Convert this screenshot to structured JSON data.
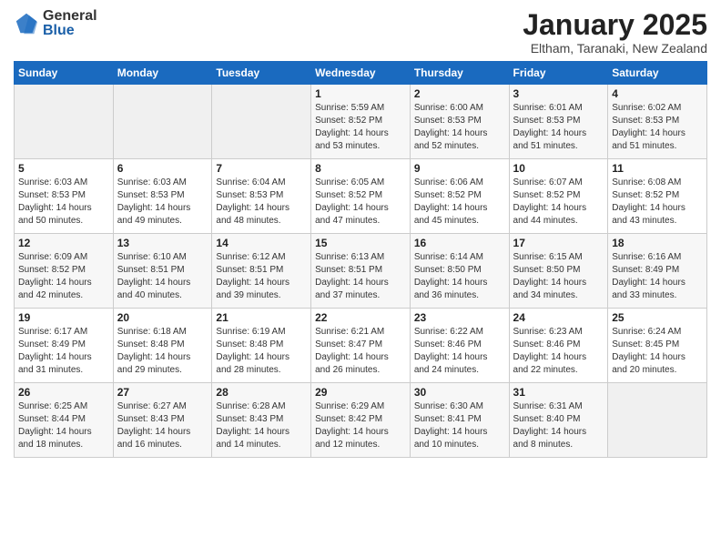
{
  "header": {
    "logo_general": "General",
    "logo_blue": "Blue",
    "month_title": "January 2025",
    "location": "Eltham, Taranaki, New Zealand"
  },
  "days_of_week": [
    "Sunday",
    "Monday",
    "Tuesday",
    "Wednesday",
    "Thursday",
    "Friday",
    "Saturday"
  ],
  "weeks": [
    [
      {
        "day": "",
        "info": ""
      },
      {
        "day": "",
        "info": ""
      },
      {
        "day": "",
        "info": ""
      },
      {
        "day": "1",
        "info": "Sunrise: 5:59 AM\nSunset: 8:52 PM\nDaylight: 14 hours\nand 53 minutes."
      },
      {
        "day": "2",
        "info": "Sunrise: 6:00 AM\nSunset: 8:53 PM\nDaylight: 14 hours\nand 52 minutes."
      },
      {
        "day": "3",
        "info": "Sunrise: 6:01 AM\nSunset: 8:53 PM\nDaylight: 14 hours\nand 51 minutes."
      },
      {
        "day": "4",
        "info": "Sunrise: 6:02 AM\nSunset: 8:53 PM\nDaylight: 14 hours\nand 51 minutes."
      }
    ],
    [
      {
        "day": "5",
        "info": "Sunrise: 6:03 AM\nSunset: 8:53 PM\nDaylight: 14 hours\nand 50 minutes."
      },
      {
        "day": "6",
        "info": "Sunrise: 6:03 AM\nSunset: 8:53 PM\nDaylight: 14 hours\nand 49 minutes."
      },
      {
        "day": "7",
        "info": "Sunrise: 6:04 AM\nSunset: 8:53 PM\nDaylight: 14 hours\nand 48 minutes."
      },
      {
        "day": "8",
        "info": "Sunrise: 6:05 AM\nSunset: 8:52 PM\nDaylight: 14 hours\nand 47 minutes."
      },
      {
        "day": "9",
        "info": "Sunrise: 6:06 AM\nSunset: 8:52 PM\nDaylight: 14 hours\nand 45 minutes."
      },
      {
        "day": "10",
        "info": "Sunrise: 6:07 AM\nSunset: 8:52 PM\nDaylight: 14 hours\nand 44 minutes."
      },
      {
        "day": "11",
        "info": "Sunrise: 6:08 AM\nSunset: 8:52 PM\nDaylight: 14 hours\nand 43 minutes."
      }
    ],
    [
      {
        "day": "12",
        "info": "Sunrise: 6:09 AM\nSunset: 8:52 PM\nDaylight: 14 hours\nand 42 minutes."
      },
      {
        "day": "13",
        "info": "Sunrise: 6:10 AM\nSunset: 8:51 PM\nDaylight: 14 hours\nand 40 minutes."
      },
      {
        "day": "14",
        "info": "Sunrise: 6:12 AM\nSunset: 8:51 PM\nDaylight: 14 hours\nand 39 minutes."
      },
      {
        "day": "15",
        "info": "Sunrise: 6:13 AM\nSunset: 8:51 PM\nDaylight: 14 hours\nand 37 minutes."
      },
      {
        "day": "16",
        "info": "Sunrise: 6:14 AM\nSunset: 8:50 PM\nDaylight: 14 hours\nand 36 minutes."
      },
      {
        "day": "17",
        "info": "Sunrise: 6:15 AM\nSunset: 8:50 PM\nDaylight: 14 hours\nand 34 minutes."
      },
      {
        "day": "18",
        "info": "Sunrise: 6:16 AM\nSunset: 8:49 PM\nDaylight: 14 hours\nand 33 minutes."
      }
    ],
    [
      {
        "day": "19",
        "info": "Sunrise: 6:17 AM\nSunset: 8:49 PM\nDaylight: 14 hours\nand 31 minutes."
      },
      {
        "day": "20",
        "info": "Sunrise: 6:18 AM\nSunset: 8:48 PM\nDaylight: 14 hours\nand 29 minutes."
      },
      {
        "day": "21",
        "info": "Sunrise: 6:19 AM\nSunset: 8:48 PM\nDaylight: 14 hours\nand 28 minutes."
      },
      {
        "day": "22",
        "info": "Sunrise: 6:21 AM\nSunset: 8:47 PM\nDaylight: 14 hours\nand 26 minutes."
      },
      {
        "day": "23",
        "info": "Sunrise: 6:22 AM\nSunset: 8:46 PM\nDaylight: 14 hours\nand 24 minutes."
      },
      {
        "day": "24",
        "info": "Sunrise: 6:23 AM\nSunset: 8:46 PM\nDaylight: 14 hours\nand 22 minutes."
      },
      {
        "day": "25",
        "info": "Sunrise: 6:24 AM\nSunset: 8:45 PM\nDaylight: 14 hours\nand 20 minutes."
      }
    ],
    [
      {
        "day": "26",
        "info": "Sunrise: 6:25 AM\nSunset: 8:44 PM\nDaylight: 14 hours\nand 18 minutes."
      },
      {
        "day": "27",
        "info": "Sunrise: 6:27 AM\nSunset: 8:43 PM\nDaylight: 14 hours\nand 16 minutes."
      },
      {
        "day": "28",
        "info": "Sunrise: 6:28 AM\nSunset: 8:43 PM\nDaylight: 14 hours\nand 14 minutes."
      },
      {
        "day": "29",
        "info": "Sunrise: 6:29 AM\nSunset: 8:42 PM\nDaylight: 14 hours\nand 12 minutes."
      },
      {
        "day": "30",
        "info": "Sunrise: 6:30 AM\nSunset: 8:41 PM\nDaylight: 14 hours\nand 10 minutes."
      },
      {
        "day": "31",
        "info": "Sunrise: 6:31 AM\nSunset: 8:40 PM\nDaylight: 14 hours\nand 8 minutes."
      },
      {
        "day": "",
        "info": ""
      }
    ]
  ]
}
